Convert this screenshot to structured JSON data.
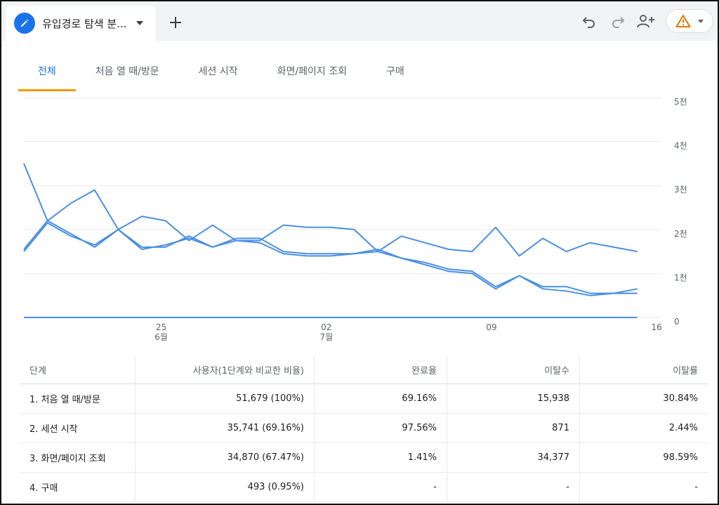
{
  "top_bar": {
    "report_tab": {
      "title": "유입경로 탐색 분...",
      "icon": "pencil-icon"
    },
    "add_tab_icon": "plus-icon",
    "actions": [
      "undo-icon",
      "redo-icon",
      "share-user-icon",
      "warning-icon"
    ],
    "accent": "#1a73e8",
    "warning_color": "#e37400"
  },
  "tabs": [
    {
      "label": "전체",
      "active": true
    },
    {
      "label": "처음 열 때/방문",
      "active": false
    },
    {
      "label": "세션 시작",
      "active": false
    },
    {
      "label": "화면/페이지 조회",
      "active": false
    },
    {
      "label": "구매",
      "active": false
    }
  ],
  "chart_data": {
    "type": "line",
    "y_ticks": [
      "5천",
      "4천",
      "3천",
      "2천",
      "1천",
      "0"
    ],
    "ylim": [
      0,
      5000
    ],
    "x_ticks": [
      {
        "day": "25",
        "month": "6월",
        "index": 6
      },
      {
        "day": "02",
        "month": "7월",
        "index": 13
      },
      {
        "day": "09",
        "month": "",
        "index": 20
      },
      {
        "day": "16",
        "month": "",
        "index": 27
      }
    ],
    "grid": true,
    "color": "#4a90e2",
    "series": [
      {
        "values": [
          3500,
          2200,
          2600,
          2900,
          2000,
          2300,
          2200,
          1750,
          2100,
          1750,
          1750,
          2100,
          2050,
          2050,
          2000,
          1500,
          1850,
          1700,
          1550,
          1500,
          2050,
          1400,
          1800,
          1500,
          1700,
          1600,
          1500
        ]
      },
      {
        "values": [
          1550,
          2200,
          1900,
          1600,
          2000,
          1600,
          1600,
          1850,
          1600,
          1800,
          1800,
          1500,
          1450,
          1450,
          1450,
          1550,
          1350,
          1250,
          1100,
          1050,
          700,
          950,
          700,
          700,
          550,
          550,
          650
        ]
      },
      {
        "values": [
          1500,
          2150,
          1850,
          1650,
          2000,
          1550,
          1650,
          1800,
          1600,
          1750,
          1700,
          1450,
          1400,
          1400,
          1450,
          1500,
          1350,
          1200,
          1050,
          1000,
          650,
          950,
          650,
          600,
          500,
          550,
          550
        ]
      },
      {
        "values": [
          0,
          0,
          0,
          0,
          0,
          0,
          0,
          0,
          0,
          0,
          0,
          0,
          0,
          0,
          0,
          0,
          0,
          0,
          0,
          0,
          0,
          0,
          0,
          0,
          0,
          0,
          0
        ]
      }
    ]
  },
  "table": {
    "headers": [
      "단계",
      "사용자(1단계와 비교한 비율)",
      "완료율",
      "이탈수",
      "이탈률"
    ],
    "rows": [
      [
        "1. 처음 열 때/방문",
        "51,679 (100%)",
        "69.16%",
        "15,938",
        "30.84%"
      ],
      [
        "2. 세션 시작",
        "35,741 (69.16%)",
        "97.56%",
        "871",
        "2.44%"
      ],
      [
        "3. 화면/페이지 조회",
        "34,870 (67.47%)",
        "1.41%",
        "34,377",
        "98.59%"
      ],
      [
        "4. 구매",
        "493 (0.95%)",
        "-",
        "-",
        "-"
      ]
    ]
  }
}
